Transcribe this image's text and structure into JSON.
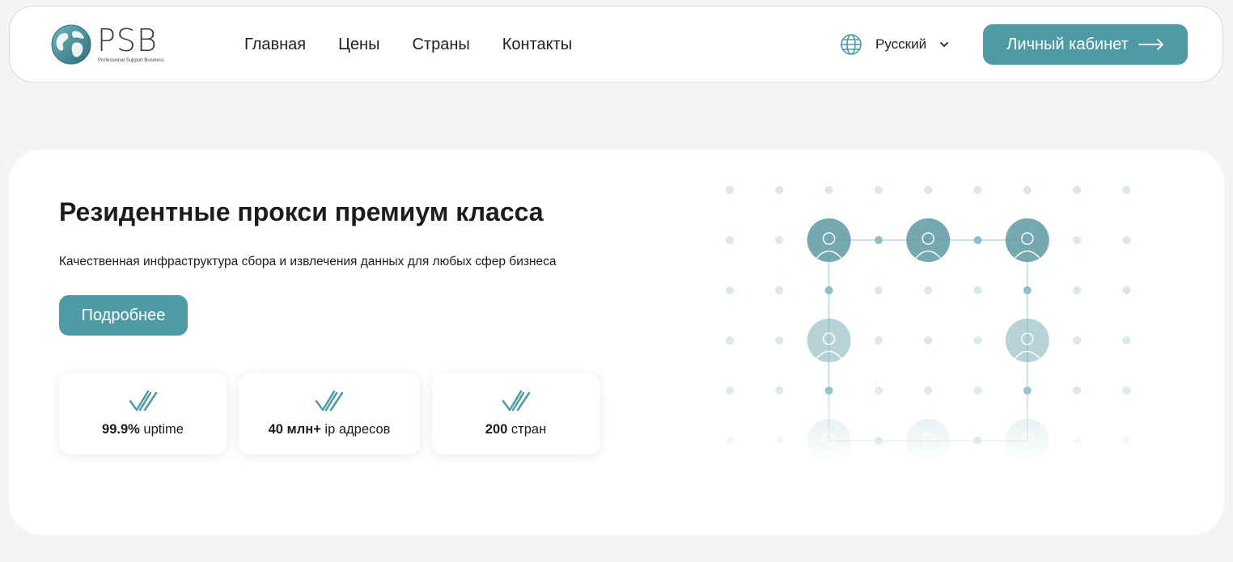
{
  "colors": {
    "accent": "#4e9aa5",
    "background": "#f4f4f4",
    "card": "#ffffff"
  },
  "logo": {
    "text": "PSB",
    "tagline": "Professional Support Business"
  },
  "nav": [
    {
      "label": "Главная"
    },
    {
      "label": "Цены"
    },
    {
      "label": "Страны"
    },
    {
      "label": "Контакты"
    }
  ],
  "language": {
    "icon": "globe-icon",
    "selected": "Русский"
  },
  "cabinet_button": {
    "label": "Личный кабинет",
    "icon": "arrow-right-icon"
  },
  "hero": {
    "title": "Резидентные прокси премиум класса",
    "subtitle": "Качественная инфраструктура сбора и извлечения данных для любых сфер бизнеса",
    "more_button": "Подробнее"
  },
  "stats": [
    {
      "value": "99.9%",
      "label": " uptime",
      "icon": "double-check-icon"
    },
    {
      "value": "40 млн+",
      "label": " ip адресов",
      "icon": "double-check-icon"
    },
    {
      "value": "200",
      "label": " стран",
      "icon": "double-check-icon"
    }
  ]
}
